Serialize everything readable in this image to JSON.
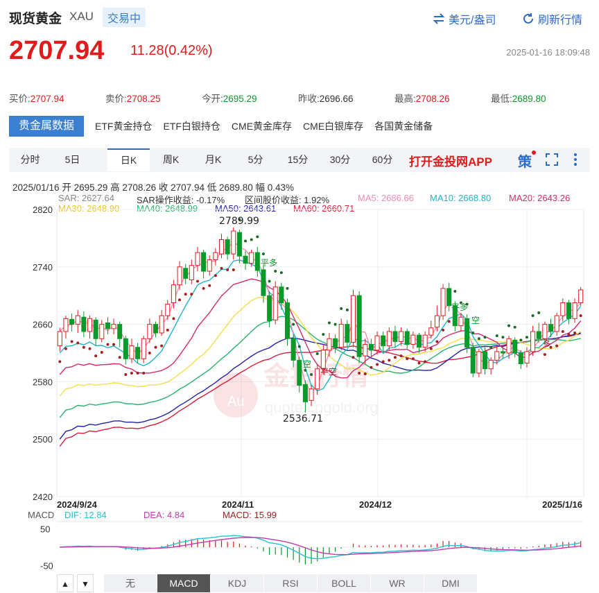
{
  "header": {
    "name": "现货黄金",
    "symbol": "XAU",
    "status": "交易中",
    "currency_toggle": "美元/盎司",
    "refresh": "刷新行情",
    "price": "2707.94",
    "change": "11.28(0.42%)",
    "timestamp": "2025-01-16 18:09:48"
  },
  "quote": [
    {
      "label": "买价:",
      "value": "2707.94",
      "color": "red"
    },
    {
      "label": "卖价:",
      "value": "2708.25",
      "color": "red"
    },
    {
      "label": "今开:",
      "value": "2695.29",
      "color": "green"
    },
    {
      "label": "昨收:",
      "value": "2696.66",
      "color": "dark"
    },
    {
      "label": "最高:",
      "value": "2708.26",
      "color": "red"
    },
    {
      "label": "最低:",
      "value": "2689.80",
      "color": "green"
    }
  ],
  "data_tabs": [
    "贵金属数据",
    "ETF黄金持仓",
    "ETF白银持仓",
    "CME黄金库存",
    "CME白银库存",
    "各国黄金储备"
  ],
  "period_tabs": [
    "分时",
    "5日",
    "日K",
    "周K",
    "月K",
    "5分",
    "15分",
    "30分",
    "60分"
  ],
  "app_link": "打开金投网APP",
  "strategy_icon": "策",
  "fullscreen_icon": "fullscreen-icon",
  "more_icon": "more-icon",
  "bar_info": "2025/01/16  开 2695.29  高 2708.26  收 2707.94  低 2689.80  幅 0.43%",
  "indicators_row1": {
    "sar": "SAR: 2627.64",
    "sar_op": "SAR操作收益: -0.17%",
    "range": "区间股价收益: 1.92%",
    "ma5": "MA5: 2686.66",
    "ma10": "MA10: 2668.80",
    "ma20": "MA20: 2643.26"
  },
  "indicators_row2": {
    "ma30": "MA30: 2648.90",
    "ma40": "MA40: 2648.99",
    "ma50": "MA50: 2643.61",
    "ma60": "MA60: 2660.71"
  },
  "annotations": {
    "high": "2789.99",
    "low": "2536.71",
    "ping_duo": "平多",
    "kong": "空",
    "ping_kong": "平空",
    "duo": "多"
  },
  "watermark": {
    "cn": "金投行情",
    "url": "quote.cngold.org"
  },
  "macd_info": {
    "label": "MACD",
    "dif": "DIF: 12.84",
    "dea": "DEA: 4.84",
    "macd": "MACD: 15.99"
  },
  "macd_ticks": [
    "50",
    "-50"
  ],
  "indicator_tabs": [
    "无",
    "MACD",
    "KDJ",
    "RSI",
    "BOLL",
    "WR",
    "DMI"
  ],
  "nav": {
    "up": "▲",
    "down": "▼"
  },
  "colors": {
    "up": "#e01b1b",
    "down": "#0a9a2a",
    "ma5": "#f28cb8",
    "ma10": "#1fb5c9",
    "ma20": "#d9286b",
    "ma30": "#f0e04a",
    "ma40": "#29b36a",
    "ma50": "#2222a8",
    "ma60": "#d81b3a",
    "sar": "#1a6a2a",
    "sar_up": "#a32020",
    "dif": "#29c0d0",
    "dea": "#c23bb0",
    "accent": "#2d6bc4"
  },
  "chart_data": {
    "type": "candlestick",
    "y_ticks": [
      2820,
      2740,
      2660,
      2580,
      2500,
      2420
    ],
    "ylim": [
      2420,
      2820
    ],
    "x_labels": [
      "2024/9/24",
      "2024/11",
      "2024/12",
      "2025/1/16"
    ],
    "series": [
      {
        "name": "candles",
        "ohlc": [
          [
            2630,
            2650,
            2622,
            2655
          ],
          [
            2650,
            2668,
            2640,
            2672
          ],
          [
            2667,
            2660,
            2650,
            2675
          ],
          [
            2660,
            2672,
            2648,
            2680
          ],
          [
            2670,
            2650,
            2642,
            2678
          ],
          [
            2650,
            2668,
            2640,
            2672
          ],
          [
            2666,
            2640,
            2630,
            2670
          ],
          [
            2640,
            2660,
            2635,
            2666
          ],
          [
            2662,
            2654,
            2646,
            2670
          ],
          [
            2654,
            2660,
            2646,
            2668
          ],
          [
            2660,
            2640,
            2628,
            2664
          ],
          [
            2640,
            2612,
            2604,
            2644
          ],
          [
            2612,
            2630,
            2606,
            2640
          ],
          [
            2628,
            2612,
            2606,
            2634
          ],
          [
            2612,
            2640,
            2606,
            2644
          ],
          [
            2640,
            2660,
            2634,
            2668
          ],
          [
            2660,
            2648,
            2642,
            2664
          ],
          [
            2648,
            2672,
            2644,
            2680
          ],
          [
            2672,
            2688,
            2666,
            2694
          ],
          [
            2690,
            2715,
            2682,
            2722
          ],
          [
            2715,
            2740,
            2708,
            2748
          ],
          [
            2738,
            2724,
            2716,
            2744
          ],
          [
            2722,
            2742,
            2716,
            2750
          ],
          [
            2742,
            2760,
            2734,
            2768
          ],
          [
            2760,
            2734,
            2724,
            2764
          ],
          [
            2734,
            2750,
            2728,
            2756
          ],
          [
            2750,
            2760,
            2742,
            2766
          ],
          [
            2758,
            2778,
            2752,
            2786
          ],
          [
            2778,
            2758,
            2750,
            2782
          ],
          [
            2758,
            2790,
            2750,
            2795
          ],
          [
            2788,
            2755,
            2745,
            2792
          ],
          [
            2755,
            2745,
            2736,
            2762
          ],
          [
            2745,
            2760,
            2740,
            2764
          ],
          [
            2760,
            2735,
            2726,
            2768
          ],
          [
            2736,
            2700,
            2690,
            2744
          ],
          [
            2700,
            2665,
            2656,
            2706
          ],
          [
            2666,
            2712,
            2660,
            2720
          ],
          [
            2712,
            2690,
            2680,
            2718
          ],
          [
            2690,
            2640,
            2630,
            2696
          ],
          [
            2640,
            2610,
            2600,
            2646
          ],
          [
            2610,
            2575,
            2565,
            2615
          ],
          [
            2576,
            2552,
            2537,
            2582
          ],
          [
            2554,
            2570,
            2546,
            2576
          ],
          [
            2570,
            2598,
            2562,
            2605
          ],
          [
            2598,
            2624,
            2590,
            2632
          ],
          [
            2624,
            2640,
            2615,
            2648
          ],
          [
            2640,
            2628,
            2620,
            2646
          ],
          [
            2628,
            2660,
            2624,
            2668
          ],
          [
            2660,
            2635,
            2628,
            2666
          ],
          [
            2635,
            2700,
            2628,
            2708
          ],
          [
            2700,
            2615,
            2606,
            2706
          ],
          [
            2616,
            2632,
            2605,
            2640
          ],
          [
            2632,
            2624,
            2614,
            2640
          ],
          [
            2624,
            2644,
            2618,
            2650
          ],
          [
            2644,
            2630,
            2622,
            2650
          ],
          [
            2630,
            2650,
            2624,
            2656
          ],
          [
            2650,
            2636,
            2628,
            2658
          ],
          [
            2636,
            2650,
            2630,
            2656
          ],
          [
            2650,
            2632,
            2626,
            2654
          ],
          [
            2632,
            2645,
            2626,
            2650
          ],
          [
            2645,
            2628,
            2620,
            2648
          ],
          [
            2628,
            2645,
            2622,
            2650
          ],
          [
            2645,
            2655,
            2640,
            2665
          ],
          [
            2656,
            2672,
            2650,
            2686
          ],
          [
            2672,
            2710,
            2666,
            2716
          ],
          [
            2710,
            2686,
            2678,
            2718
          ],
          [
            2686,
            2658,
            2650,
            2692
          ],
          [
            2658,
            2670,
            2650,
            2676
          ],
          [
            2668,
            2628,
            2620,
            2674
          ],
          [
            2628,
            2592,
            2586,
            2634
          ],
          [
            2592,
            2622,
            2586,
            2626
          ],
          [
            2622,
            2598,
            2590,
            2628
          ],
          [
            2598,
            2610,
            2590,
            2614
          ],
          [
            2610,
            2622,
            2604,
            2630
          ],
          [
            2622,
            2620,
            2612,
            2628
          ],
          [
            2620,
            2640,
            2612,
            2644
          ],
          [
            2638,
            2620,
            2614,
            2642
          ],
          [
            2620,
            2605,
            2598,
            2624
          ],
          [
            2606,
            2622,
            2600,
            2628
          ],
          [
            2622,
            2650,
            2616,
            2658
          ],
          [
            2650,
            2640,
            2634,
            2662
          ],
          [
            2640,
            2660,
            2632,
            2664
          ],
          [
            2660,
            2650,
            2642,
            2668
          ],
          [
            2650,
            2672,
            2644,
            2676
          ],
          [
            2672,
            2690,
            2664,
            2696
          ],
          [
            2690,
            2668,
            2660,
            2694
          ],
          [
            2668,
            2690,
            2662,
            2696
          ],
          [
            2690,
            2708,
            2686,
            2712
          ]
        ]
      },
      {
        "name": "MA5"
      },
      {
        "name": "MA10"
      },
      {
        "name": "MA20"
      },
      {
        "name": "MA30"
      },
      {
        "name": "MA40"
      },
      {
        "name": "MA50"
      },
      {
        "name": "MA60"
      },
      {
        "name": "SAR"
      },
      {
        "name": "DIF"
      },
      {
        "name": "DEA"
      },
      {
        "name": "MACD"
      }
    ],
    "macd_ylim": [
      -70,
      70
    ]
  }
}
